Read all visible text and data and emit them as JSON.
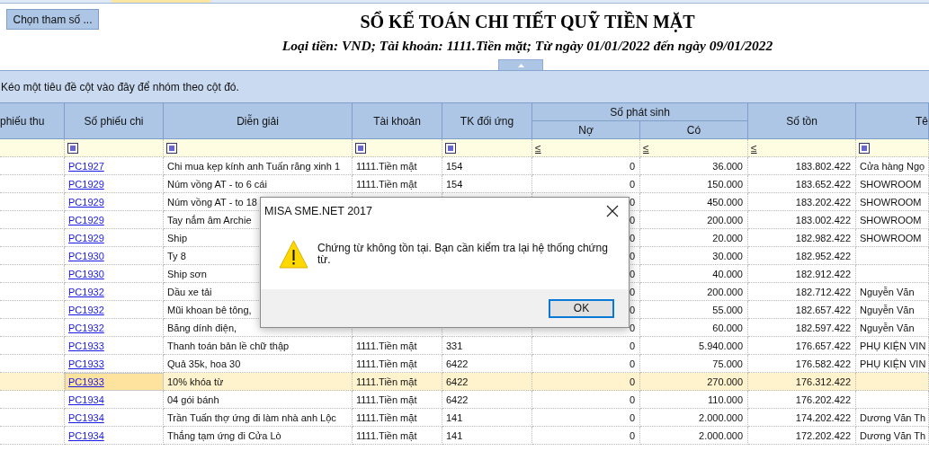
{
  "toolbar": {
    "parameters_button": "Chọn tham số ..."
  },
  "report": {
    "title": "SỔ KẾ TOÁN CHI TIẾT QUỸ TIỀN MẶT",
    "subtitle": "Loại tiền: VND; Tài khoản: 1111.Tiền mặt; Từ ngày 01/01/2022 đến ngày 09/01/2022"
  },
  "group_panel": {
    "hint": "Kéo một tiêu đề cột vào đây để nhóm theo cột đó."
  },
  "table": {
    "group_header": "Số phát sinh",
    "columns": [
      {
        "label": "phiếu thu",
        "grouped": false
      },
      {
        "label": "Số phiếu chi",
        "grouped": false,
        "filter": {
          "kind": "square"
        }
      },
      {
        "label": "Diễn giải",
        "grouped": false,
        "filter": {
          "kind": "square"
        }
      },
      {
        "label": "Tài khoản",
        "grouped": false,
        "filter": {
          "kind": "square"
        }
      },
      {
        "label": "TK đối ứng",
        "grouped": false,
        "filter": {
          "kind": "square"
        }
      },
      {
        "label": "Nợ",
        "grouped": true,
        "filter": {
          "kind": "operator",
          "operator": "≤"
        }
      },
      {
        "label": "Có",
        "grouped": true,
        "filter": {
          "kind": "operator",
          "operator": "≤"
        }
      },
      {
        "label": "Số tồn",
        "grouped": false,
        "filter": {
          "kind": "operator",
          "operator": "≤"
        }
      },
      {
        "label": "Tê",
        "grouped": false,
        "filter": {
          "kind": "square"
        }
      }
    ],
    "rows": [
      {
        "voucher": "PC1927",
        "description": "Chi mua kẹp kính anh Tuấn răng xinh 1",
        "account": "1111.Tiền mặt",
        "contra": "154",
        "debit": "0",
        "credit": "36.000",
        "balance": "183.802.422",
        "name": "Cửa hàng Ngọ",
        "selected": false
      },
      {
        "voucher": "PC1929",
        "description": "Núm vồng AT - to 6 cái",
        "account": "1111.Tiền mặt",
        "contra": "154",
        "debit": "0",
        "credit": "150.000",
        "balance": "183.652.422",
        "name": "SHOWROOM",
        "selected": false
      },
      {
        "voucher": "PC1929",
        "description": "Núm vồng AT - to 18",
        "debit": "0",
        "credit": "450.000",
        "balance": "183.202.422",
        "name": "SHOWROOM",
        "selected": false
      },
      {
        "voucher": "PC1929",
        "description": "Tay nắm âm Archie",
        "debit": "0",
        "credit": "200.000",
        "balance": "183.002.422",
        "name": "SHOWROOM",
        "selected": false
      },
      {
        "voucher": "PC1929",
        "description": "Ship",
        "debit": "0",
        "credit": "20.000",
        "balance": "182.982.422",
        "name": "SHOWROOM",
        "selected": false
      },
      {
        "voucher": "PC1930",
        "description": "Ty 8",
        "debit": "0",
        "credit": "30.000",
        "balance": "182.952.422",
        "selected": false
      },
      {
        "voucher": "PC1930",
        "description": "Ship sơn",
        "debit": "0",
        "credit": "40.000",
        "balance": "182.912.422",
        "selected": false
      },
      {
        "voucher": "PC1932",
        "description": "Dầu xe tải",
        "debit": "0",
        "credit": "200.000",
        "balance": "182.712.422",
        "name": "Nguyễn Văn",
        "selected": false
      },
      {
        "voucher": "PC1932",
        "description": "Mũi khoan bê tông,",
        "debit": "0",
        "credit": "55.000",
        "balance": "182.657.422",
        "name": "Nguyễn Văn",
        "selected": false
      },
      {
        "voucher": "PC1932",
        "description": "Băng dính điện,",
        "debit": "0",
        "credit": "60.000",
        "balance": "182.597.422",
        "name": "Nguyễn Văn",
        "selected": false
      },
      {
        "voucher": "PC1933",
        "description": "Thanh toán bản lề chữ thập",
        "account": "1111.Tiền mặt",
        "contra": "331",
        "debit": "0",
        "credit": "5.940.000",
        "balance": "176.657.422",
        "name": "PHỤ KIỆN VIN",
        "selected": false
      },
      {
        "voucher": "PC1933",
        "description": "Quả 35k, hoa 30",
        "account": "1111.Tiền mặt",
        "contra": "6422",
        "debit": "0",
        "credit": "75.000",
        "balance": "176.582.422",
        "name": "PHỤ KIỆN VIN",
        "selected": false
      },
      {
        "voucher": "PC1933",
        "description": "10% khóa từ",
        "account": "1111.Tiền mặt",
        "contra": "6422",
        "debit": "0",
        "credit": "270.000",
        "balance": "176.312.422",
        "selected": true
      },
      {
        "voucher": "PC1934",
        "description": "04 gói bánh",
        "account": "1111.Tiền mặt",
        "contra": "6422",
        "debit": "0",
        "credit": "110.000",
        "balance": "176.202.422",
        "selected": false
      },
      {
        "voucher": "PC1934",
        "description": "Trần Tuấn thợ  ứng đi làm nhà anh Lộc",
        "account": "1111.Tiền mặt",
        "contra": "141",
        "debit": "0",
        "credit": "2.000.000",
        "balance": "174.202.422",
        "name": "Dương Văn Th",
        "selected": false
      },
      {
        "voucher": "PC1934",
        "description": "Thắng tạm ứng  đi Cửa Lò",
        "account": "1111.Tiền mặt",
        "contra": "141",
        "debit": "0",
        "credit": "2.000.000",
        "balance": "172.202.422",
        "name": "Dương Văn Th",
        "selected": false
      }
    ]
  },
  "dialog": {
    "title": "MISA SME.NET 2017",
    "message": "Chứng từ không tồn tại. Bạn cần kiểm tra lại hệ thống chứng từ.",
    "button": "OK"
  }
}
